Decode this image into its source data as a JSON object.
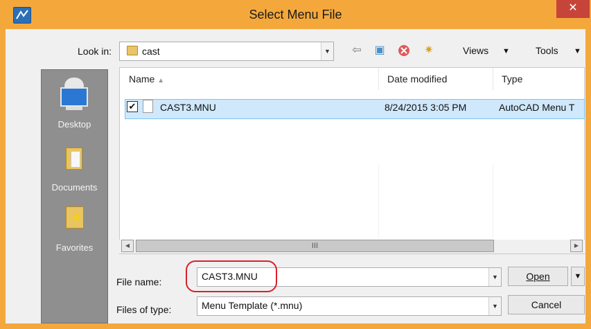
{
  "window": {
    "title": "Select Menu File",
    "close_glyph": "✕"
  },
  "look_in": {
    "label": "Look in:",
    "value": "cast"
  },
  "toolbar": {
    "views_label": "Views",
    "tools_label": "Tools"
  },
  "places": [
    {
      "label": "Desktop",
      "icon": "desktop-icon"
    },
    {
      "label": "Documents",
      "icon": "documents-icon"
    },
    {
      "label": "Favorites",
      "icon": "favorites-icon"
    }
  ],
  "columns": {
    "name": "Name",
    "date": "Date modified",
    "type": "Type"
  },
  "files": [
    {
      "name": "CAST3.MNU",
      "date": "8/24/2015 3:05 PM",
      "type": "AutoCAD Menu T",
      "checked": true
    }
  ],
  "scrollbar": {
    "thumb_glyph": "III"
  },
  "file_name": {
    "label": "File name:",
    "value": "CAST3.MNU"
  },
  "file_type": {
    "label": "Files of type:",
    "value": "Menu Template (*.mnu)"
  },
  "buttons": {
    "open": "Open",
    "cancel": "Cancel"
  },
  "colors": {
    "frame": "#f4a83c",
    "close": "#c7443a",
    "highlight_oval": "#d9202a",
    "selection": "#cfe8fb"
  }
}
